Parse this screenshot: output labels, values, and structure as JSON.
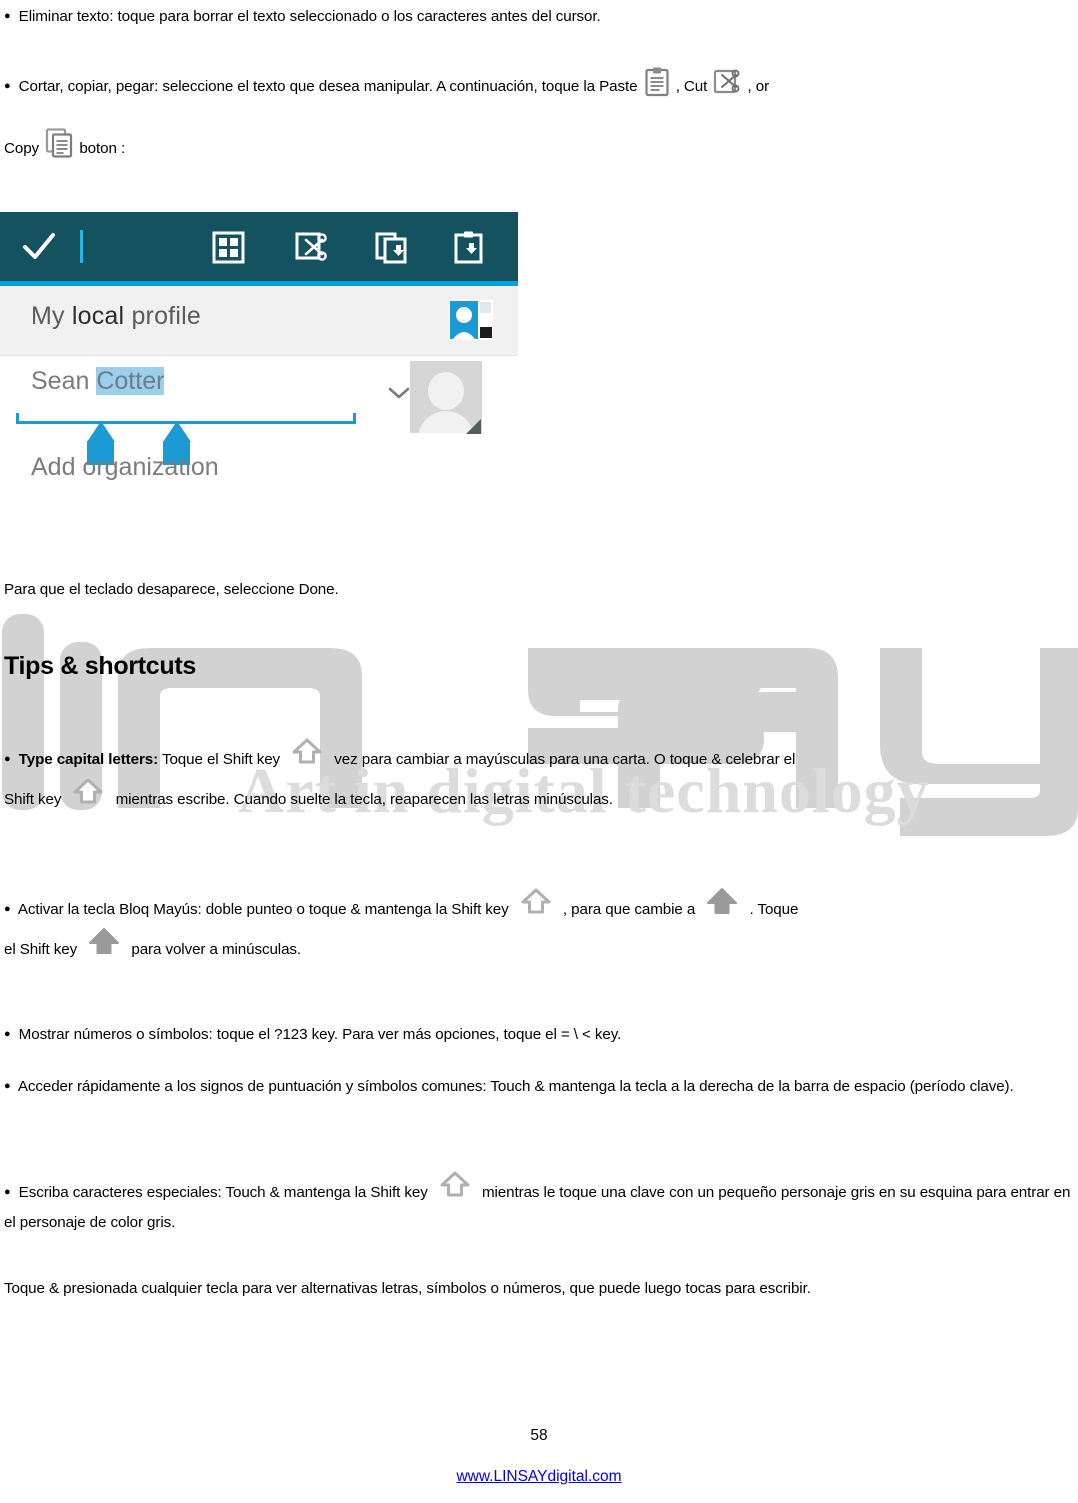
{
  "document": {
    "page_number": "58",
    "footer_link": "www.LINSAYdigital.com"
  },
  "watermark": {
    "brand": "linsay",
    "tagline": "Art in digital technology"
  },
  "body": {
    "p_delete": "Eliminar texto: toque para borrar el texto seleccionado o los caracteres antes del cursor.",
    "p_cutcopy_part1": "Cortar, copiar, pegar: seleccione el texto que desea manipular. A continuación, toque la Paste",
    "p_cutcopy_sep1": ", Cut",
    "p_cutcopy_sep2": ", or",
    "p_cutcopy_copylabel": "Copy",
    "p_cutcopy_end": "boton :",
    "p_keyboard_done": "Para que el teclado desaparece, seleccione Done.",
    "heading_tips": "Tips & shortcuts",
    "p_capital_bold": "Type capital letters:",
    "p_capital_part1": "Toque el Shift key",
    "p_capital_part2": "vez para cambiar a mayúsculas para una carta. O toque & celebrar el",
    "p_capital_part3": "Shift key",
    "p_capital_part4": "mientras escribe. Cuando suelte la tecla, reaparecen las letras minúsculas.",
    "p_caps_part1": "Activar la tecla Bloq Mayús: doble punteo o toque & mantenga la Shift key",
    "p_caps_part2": ", para que cambie a",
    "p_caps_part3": ". Toque",
    "p_caps_part4": "el Shift key",
    "p_caps_part5": "para volver a minúsculas.",
    "p_numbers": "Mostrar números o símbolos: toque el ?123 key. Para ver más opciones, toque el = \\ < key.",
    "p_punct_line1": "Acceder rápidamente a los signos de puntuación y símbolos comunes: Touch & mantenga la tecla a la derecha de",
    "p_punct_line2": "la barra de espacio (período clave).",
    "p_special_part1": "Escriba caracteres especiales: Touch & mantenga la Shift key",
    "p_special_part2": "mientras le toque una clave con un pequeño",
    "p_special_line2": "personaje gris en su esquina para entrar en el personaje de color gris.",
    "p_longpress_line1": "Toque & presionada cualquier tecla para ver alternativas letras, símbolos o números, que puede luego tocas para",
    "p_longpress_line2": "escribir."
  },
  "screenshot": {
    "profile_label_my": "My ",
    "profile_label_local": "local",
    "profile_label_profile": " profile",
    "name_first": "Sean ",
    "name_selected": "Cotter",
    "add_org": "Add organization",
    "colors": {
      "toolbar": "#15525f",
      "accent": "#03a3e0",
      "selection": "#9ccfec",
      "handle": "#1b9ad6"
    },
    "toolbar_icons": [
      "check-icon",
      "grid-icon",
      "cut-icon",
      "copy-icon",
      "paste-icon"
    ]
  }
}
